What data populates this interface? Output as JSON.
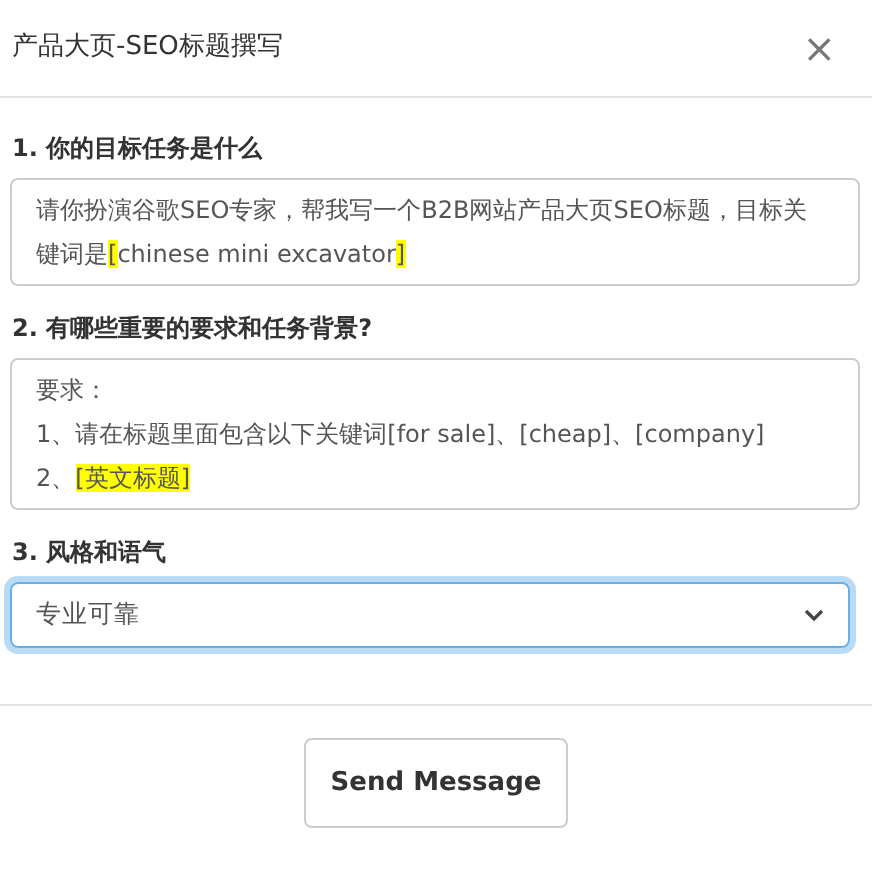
{
  "dialog": {
    "title": "产品大页-SEO标题撰写",
    "close": "×"
  },
  "questions": [
    {
      "kind": "text",
      "label": "1. 你的目标任务是什么",
      "lines": [
        [
          {
            "text": "请你扮演谷歌SEO专家，帮我写一个B2B网站产品大页SEO标题，目标关键词是",
            "highlighted": false
          },
          {
            "text": "[",
            "highlighted": true
          },
          {
            "text": "chinese mini excavator",
            "highlighted": false
          },
          {
            "text": "]",
            "highlighted": true
          }
        ]
      ]
    },
    {
      "kind": "text",
      "label": "2. 有哪些重要的要求和任务背景?",
      "lines": [
        [
          {
            "text": "要求：",
            "highlighted": false
          }
        ],
        [
          {
            "text": "1、请在标题里面包含以下关键词[for sale]、[cheap]、[company]",
            "highlighted": false
          }
        ],
        [
          {
            "text": "2、",
            "highlighted": false
          },
          {
            "text": "[英文标题]",
            "highlighted": true
          }
        ]
      ]
    },
    {
      "kind": "select",
      "label": "3. 风格和语气",
      "value": "专业可靠",
      "focused": true
    }
  ],
  "send_button": "Send Message"
}
